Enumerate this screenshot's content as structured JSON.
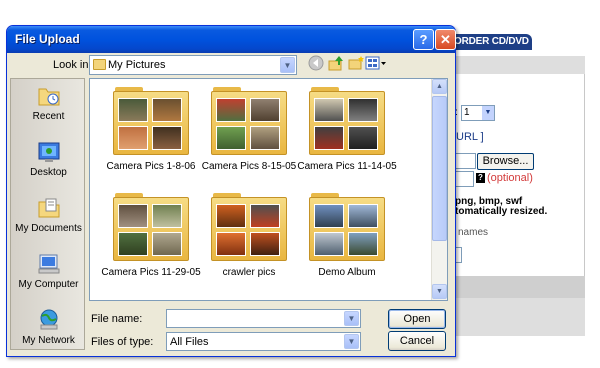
{
  "background_page": {
    "order_tab": "ORDER CD/DVD",
    "select_value": "1",
    "select_label_suffix": ":",
    "url_link": "URL ]",
    "browse_button": "Browse...",
    "optional_text": "(optional)",
    "formats_line1": "png, bmp, swf",
    "formats_line2": "tomatically resized.",
    "names_text": "names",
    "help_glyph": "?"
  },
  "dialog": {
    "title": "File Upload",
    "help_glyph": "?",
    "close_glyph": "✕",
    "look_in_label": "Look in:",
    "look_in_value": "My Pictures",
    "places": [
      {
        "label": "Recent",
        "icon": "recent-icon"
      },
      {
        "label": "Desktop",
        "icon": "desktop-icon"
      },
      {
        "label": "My Documents",
        "icon": "my-documents-icon"
      },
      {
        "label": "My Computer",
        "icon": "my-computer-icon"
      },
      {
        "label": "My Network",
        "icon": "my-network-icon"
      }
    ],
    "folders": [
      {
        "name": "Camera Pics 1-8-06"
      },
      {
        "name": "Camera Pics 8-15-05"
      },
      {
        "name": "Camera Pics 11-14-05"
      },
      {
        "name": "Camera Pics 11-29-05"
      },
      {
        "name": "crawler pics"
      },
      {
        "name": "Demo Album"
      }
    ],
    "file_name_label": "File name:",
    "file_name_value": "",
    "files_of_type_label": "Files of type:",
    "files_of_type_value": "All Files",
    "open_button": "Open",
    "cancel_button": "Cancel"
  },
  "colors": {
    "titlebar": "#0052de",
    "dialog_face": "#ece9d8",
    "order_tab": "#1e3f86",
    "optional": "#d33a3a"
  }
}
